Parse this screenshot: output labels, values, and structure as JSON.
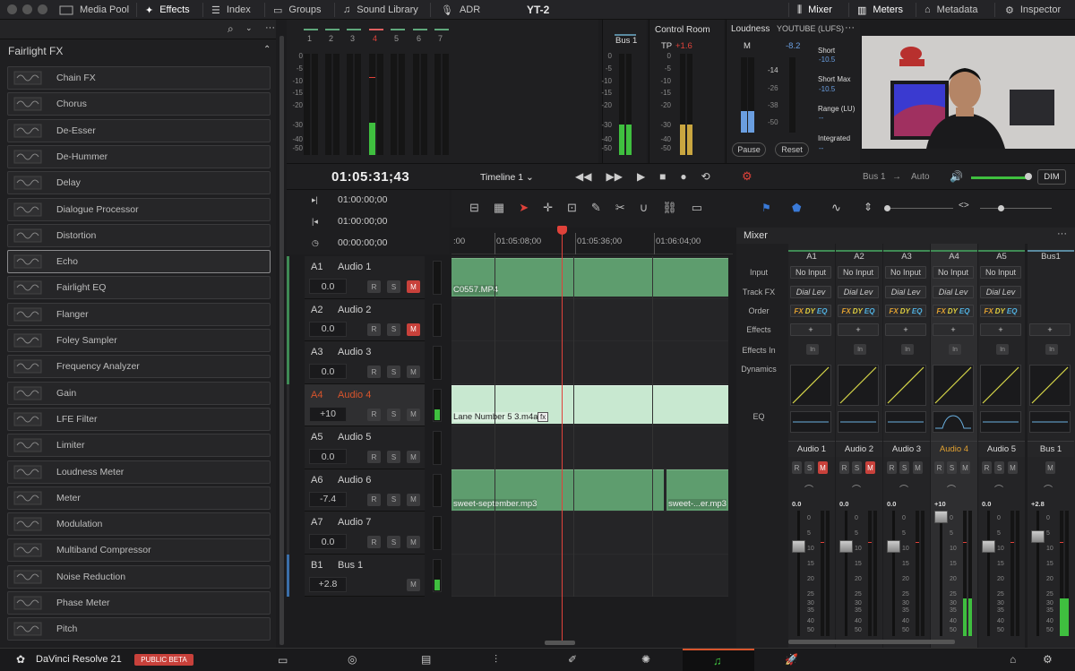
{
  "topbar": {
    "tabs": [
      "Media Pool",
      "Effects",
      "Index",
      "Groups",
      "Sound Library",
      "ADR"
    ],
    "project": "YT-2",
    "right_tabs": [
      "Mixer",
      "Meters",
      "Metadata",
      "Inspector"
    ]
  },
  "fx": {
    "title": "Fairlight FX",
    "items": [
      "Chain FX",
      "Chorus",
      "De-Esser",
      "De-Hummer",
      "Delay",
      "Dialogue Processor",
      "Distortion",
      "Echo",
      "Fairlight EQ",
      "Flanger",
      "Foley Sampler",
      "Frequency Analyzer",
      "Gain",
      "LFE Filter",
      "Limiter",
      "Loudness Meter",
      "Meter",
      "Modulation",
      "Multiband Compressor",
      "Noise Reduction",
      "Phase Meter",
      "Pitch"
    ]
  },
  "meters": {
    "channels": [
      "1",
      "2",
      "3",
      "4",
      "5",
      "6",
      "7"
    ],
    "scale": [
      "0",
      "-5",
      "-10",
      "-15",
      "-20",
      "-30",
      "-40",
      "-50"
    ],
    "bus_label": "Bus 1",
    "control_room": "Control Room",
    "tp_label": "TP",
    "tp_value": "+1.6"
  },
  "loudness": {
    "title": "Loudness",
    "standard": "YOUTUBE (LUFS)",
    "m_label": "M",
    "m_value": "-8.2",
    "scale": [
      "-14",
      "-26",
      "-38",
      "-50"
    ],
    "short": "Short",
    "short_val": "-10.5",
    "short_max": "Short Max",
    "short_max_val": "-10.5",
    "range": "Range (LU)",
    "range_val": "--",
    "integrated": "Integrated",
    "integrated_val": "--",
    "pause": "Pause",
    "reset": "Reset"
  },
  "transport": {
    "timecode": "01:05:31;43",
    "timeline": "Timeline 1",
    "bus_out": "Bus 1",
    "arrow": "→",
    "auto": "Auto",
    "dim": "DIM"
  },
  "timecodes": [
    "01:00:00;00",
    "01:00:00;00",
    "00:00:00;00"
  ],
  "ruler": [
    ":00",
    "01:05:08;00",
    "01:05:36;00",
    "01:06:04;00"
  ],
  "tracks": [
    {
      "id": "A1",
      "name": "Audio 1",
      "vol": "0.0"
    },
    {
      "id": "A2",
      "name": "Audio 2",
      "vol": "0.0"
    },
    {
      "id": "A3",
      "name": "Audio 3",
      "vol": "0.0"
    },
    {
      "id": "A4",
      "name": "Audio 4",
      "vol": "+10"
    },
    {
      "id": "A5",
      "name": "Audio 5",
      "vol": "0.0"
    },
    {
      "id": "A6",
      "name": "Audio 6",
      "vol": "-7.4"
    },
    {
      "id": "A7",
      "name": "Audio 7",
      "vol": "0.0"
    },
    {
      "id": "B1",
      "name": "Bus 1",
      "vol": "+2.8"
    }
  ],
  "clips": {
    "c1": "C0557.MP4",
    "c2": "Lane Number 5 3.m4a",
    "c2fx": "fx",
    "c3": "sweet-september.mp3",
    "c4": "sweet-...er.mp3"
  },
  "mixer": {
    "title": "Mixer",
    "cols": [
      "A1",
      "A2",
      "A3",
      "A4",
      "A5",
      "Bus1"
    ],
    "rows": [
      "Input",
      "Track FX",
      "Order",
      "Effects",
      "Effects In",
      "Dynamics",
      "EQ"
    ],
    "input": "No Input",
    "trackfx": "Dial Lev",
    "order": [
      "FX",
      "DY",
      "EQ"
    ],
    "plus": "+",
    "in": "In",
    "names": [
      "Audio 1",
      "Audio 2",
      "Audio 3",
      "Audio 4",
      "Audio 5",
      "Bus 1"
    ],
    "levels": [
      "0.0",
      "0.0",
      "0.0",
      "+10",
      "0.0",
      "+2.8"
    ],
    "fscale": [
      "0",
      "5",
      "10",
      "15",
      "20",
      "25",
      "30",
      "35",
      "40",
      "50"
    ]
  },
  "bottom": {
    "app": "DaVinci Resolve 21",
    "beta": "PUBLIC BETA"
  },
  "colors": {
    "accent": "#e0423a",
    "clip": "#5e9d6e",
    "selected": "#d8542c",
    "meter": "#3fbf3f",
    "loud": "#6a9ee0"
  }
}
